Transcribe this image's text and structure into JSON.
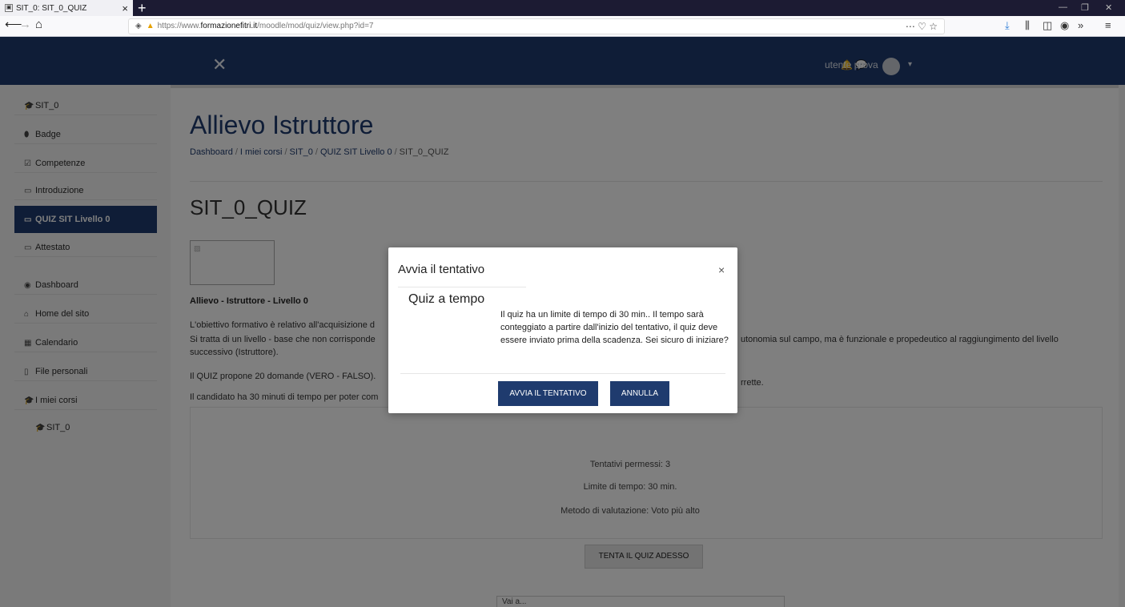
{
  "browser": {
    "tab_title": "SIT_0: SIT_0_QUIZ",
    "url_prefix": "https://www.",
    "url_domain": "formazionefitri.it",
    "url_path": "/moodle/mod/quiz/view.php?id=7",
    "url_right_icons": "⋯ ♡ ☆"
  },
  "header": {
    "user_name": "utente prova"
  },
  "drawer": {
    "items": [
      {
        "icon": "🎓",
        "label": "SIT_0"
      },
      {
        "icon": "⬮",
        "label": "Badge"
      },
      {
        "icon": "☑",
        "label": "Competenze"
      },
      {
        "icon": "▭",
        "label": "Introduzione"
      },
      {
        "icon": "▭",
        "label": "QUIZ SIT Livello 0"
      },
      {
        "icon": "▭",
        "label": "Attestato"
      },
      {
        "icon": "◉",
        "label": "Dashboard"
      },
      {
        "icon": "⌂",
        "label": "Home del sito"
      },
      {
        "icon": "▦",
        "label": "Calendario"
      },
      {
        "icon": "▯",
        "label": "File personali"
      },
      {
        "icon": "🎓",
        "label": "I miei corsi"
      },
      {
        "icon": "🎓",
        "label": "SIT_0"
      }
    ]
  },
  "main": {
    "course_heading": "Allievo Istruttore",
    "breadcrumb": [
      "Dashboard",
      "I miei corsi",
      "SIT_0",
      "QUIZ SIT Livello 0",
      "SIT_0_QUIZ"
    ],
    "quiz_heading": "SIT_0_QUIZ",
    "quiz_title": "Allievo - Istruttore - Livello 0",
    "para1a": "L'obiettivo formativo è relativo all'acquisizione d",
    "para2a": "Si tratta di un livello - base che non corrisponde",
    "para2b": "utonomia sul campo, ma è funzionale e propedeutico al raggiungimento del livello",
    "para2c": "successivo (Istruttore).",
    "para3a": "Il QUIZ propone 20 domande (VERO - FALSO).",
    "para3b": "rrette.",
    "para4a": "Il candidato ha 30 minuti di tempo per poter com",
    "info_attempts": "Tentativi permessi: 3",
    "info_time": "Limite di tempo: 30 min.",
    "info_method": "Metodo di valutazione: Voto più alto",
    "attempt_button": "TENTA IL QUIZ ADESSO",
    "bottom_select": "Vai a..."
  },
  "modal": {
    "title": "Avvia il tentativo",
    "close": "×",
    "subtitle": "Quiz a tempo",
    "body": "Il quiz ha un limite di tempo di 30 min.. Il tempo sarà conteggiato a partire dall'inizio del tentativo, il quiz deve essere inviato prima della scadenza. Sei sicuro di iniziare?",
    "start_button": "AVVIA IL TENTATIVO",
    "cancel_button": "ANNULLA"
  },
  "colors": {
    "brand": "#1f3b6e",
    "backdrop": "rgba(0,0,0,0.5)"
  }
}
